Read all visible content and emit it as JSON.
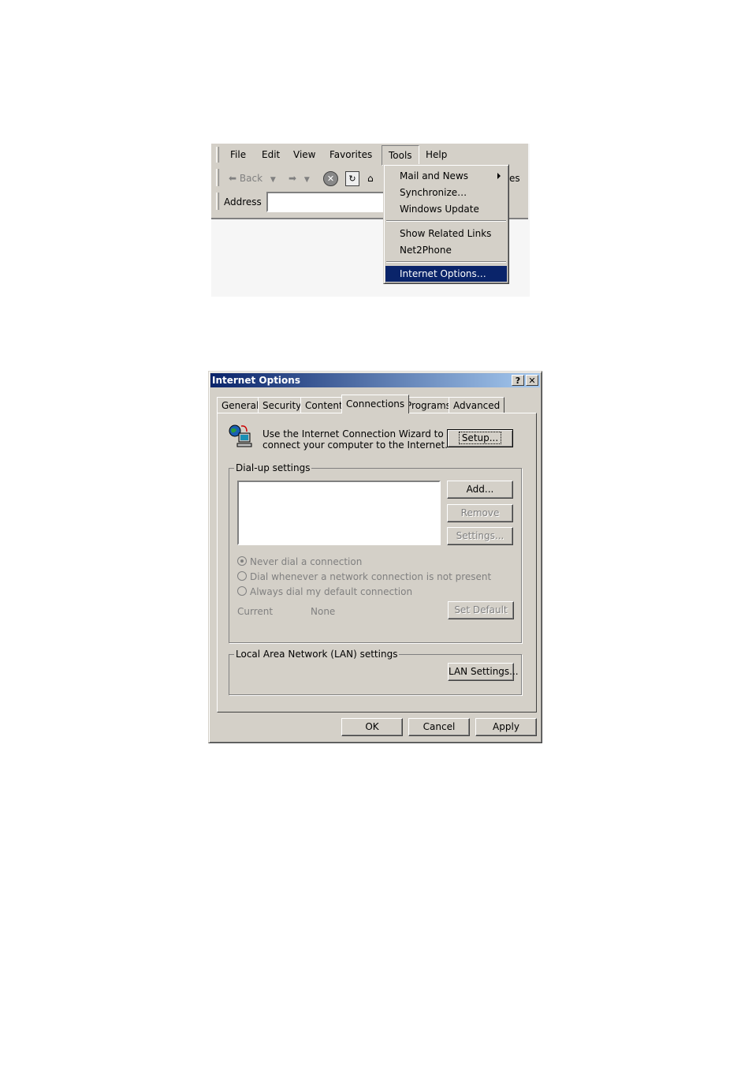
{
  "ie": {
    "menubar": [
      "File",
      "Edit",
      "View",
      "Favorites",
      "Tools",
      "Help"
    ],
    "toolbar": {
      "back_label": "Back",
      "truncated_text": "es"
    },
    "address_label": "Address",
    "tools_menu": {
      "items": [
        "Mail and News",
        "Synchronize…",
        "Windows Update",
        "Show Related Links",
        "Net2Phone",
        "Internet Options…"
      ],
      "selected": "Internet Options…"
    }
  },
  "dialog": {
    "title": "Internet Options",
    "title_buttons": {
      "help": "?",
      "close": "✕"
    },
    "tabs": [
      "General",
      "Security",
      "Content",
      "Connections",
      "Programs",
      "Advanced"
    ],
    "active_tab": "Connections",
    "wizard": {
      "line1": "Use the Internet Connection Wizard to",
      "line2": "connect your computer to the Internet.",
      "setup_button": "Setup..."
    },
    "dialup": {
      "legend": "Dial-up settings",
      "add_button": "Add...",
      "remove_button": "Remove",
      "settings_button": "Settings...",
      "radios": [
        "Never dial a connection",
        "Dial whenever a network connection is not present",
        "Always dial my default connection"
      ],
      "current_label": "Current",
      "current_value": "None",
      "set_default_button": "Set Default"
    },
    "lan": {
      "legend": "Local Area Network (LAN) settings",
      "lan_button": "LAN Settings..."
    },
    "footer": {
      "ok": "OK",
      "cancel": "Cancel",
      "apply": "Apply"
    }
  }
}
